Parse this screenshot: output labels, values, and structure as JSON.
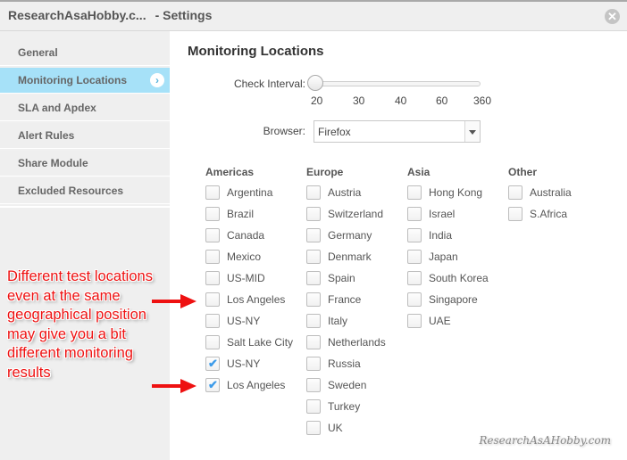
{
  "window": {
    "title": "ResearchAsaHobby.c...",
    "subtitle": "- Settings",
    "close_icon": "close-circle-icon"
  },
  "sidebar": {
    "items": [
      {
        "label": "General",
        "active": false
      },
      {
        "label": "Monitoring Locations",
        "active": true
      },
      {
        "label": "SLA and Apdex",
        "active": false
      },
      {
        "label": "Alert Rules",
        "active": false
      },
      {
        "label": "Share Module",
        "active": false
      },
      {
        "label": "Excluded Resources",
        "active": false
      }
    ],
    "active_icon": "chevron-right-circle-icon"
  },
  "main": {
    "title": "Monitoring Locations",
    "check_interval": {
      "label": "Check Interval:",
      "ticks": [
        "20",
        "30",
        "40",
        "60",
        "360"
      ],
      "value": "20"
    },
    "browser": {
      "label": "Browser:",
      "value": "Firefox"
    },
    "regions": [
      {
        "name": "Americas",
        "locations": [
          {
            "name": "Argentina",
            "checked": false
          },
          {
            "name": "Brazil",
            "checked": false
          },
          {
            "name": "Canada",
            "checked": false
          },
          {
            "name": "Mexico",
            "checked": false
          },
          {
            "name": "US-MID",
            "checked": false
          },
          {
            "name": "Los Angeles",
            "checked": false
          },
          {
            "name": "US-NY",
            "checked": false
          },
          {
            "name": "Salt Lake City",
            "checked": false
          },
          {
            "name": "US-NY",
            "checked": true
          },
          {
            "name": "Los Angeles",
            "checked": true
          }
        ]
      },
      {
        "name": "Europe",
        "locations": [
          {
            "name": "Austria",
            "checked": false
          },
          {
            "name": "Switzerland",
            "checked": false
          },
          {
            "name": "Germany",
            "checked": false
          },
          {
            "name": "Denmark",
            "checked": false
          },
          {
            "name": "Spain",
            "checked": false
          },
          {
            "name": "France",
            "checked": false
          },
          {
            "name": "Italy",
            "checked": false
          },
          {
            "name": "Netherlands",
            "checked": false
          },
          {
            "name": "Russia",
            "checked": false
          },
          {
            "name": "Sweden",
            "checked": false
          },
          {
            "name": "Turkey",
            "checked": false
          },
          {
            "name": "UK",
            "checked": false
          }
        ]
      },
      {
        "name": "Asia",
        "locations": [
          {
            "name": "Hong Kong",
            "checked": false
          },
          {
            "name": "Israel",
            "checked": false
          },
          {
            "name": "India",
            "checked": false
          },
          {
            "name": "Japan",
            "checked": false
          },
          {
            "name": "South Korea",
            "checked": false
          },
          {
            "name": "Singapore",
            "checked": false
          },
          {
            "name": "UAE",
            "checked": false
          }
        ]
      },
      {
        "name": "Other",
        "locations": [
          {
            "name": "Australia",
            "checked": false
          },
          {
            "name": "S.Africa",
            "checked": false
          }
        ]
      }
    ]
  },
  "annotation": {
    "text": "Different test locations even at the same geographical position may give you a bit different monitoring results",
    "color": "#ee1111"
  },
  "watermark": "ResearchAsAHobby.com",
  "colors": {
    "active_item": "#a6e1f8",
    "checkmark": "#3d9be9"
  }
}
